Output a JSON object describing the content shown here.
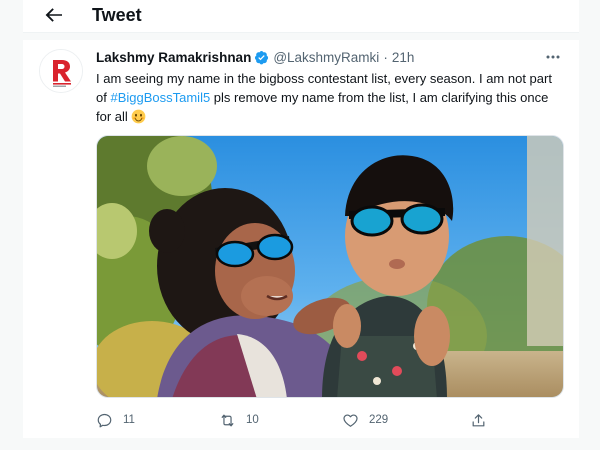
{
  "header": {
    "title": "Tweet",
    "back_icon": "arrow-left-icon"
  },
  "tweet": {
    "author": {
      "display_name": "Lakshmy Ramakrishnan",
      "handle": "@LakshmyRamki",
      "verified": true,
      "avatar_icon": "channel-logo-avatar"
    },
    "separator": "·",
    "time": "21h",
    "text": {
      "part1": "I am seeing my name in the  bigboss contestant list, every season. I am not part of ",
      "hashtag": "#BiggBossTamil5",
      "part2": " pls remove my name from the list, I am clarifying this once for all",
      "emoji_icon": "smiling-face-icon"
    },
    "media": {
      "kind": "photo",
      "icon": "photo-woman-and-child-in-sunglasses"
    },
    "actions": {
      "replies": "11",
      "retweets": "10",
      "likes": "229"
    }
  },
  "colors": {
    "accent": "#1d9bf0",
    "text": "#0f1419",
    "muted": "#536471",
    "background_gutter": "#f7f9f9"
  }
}
